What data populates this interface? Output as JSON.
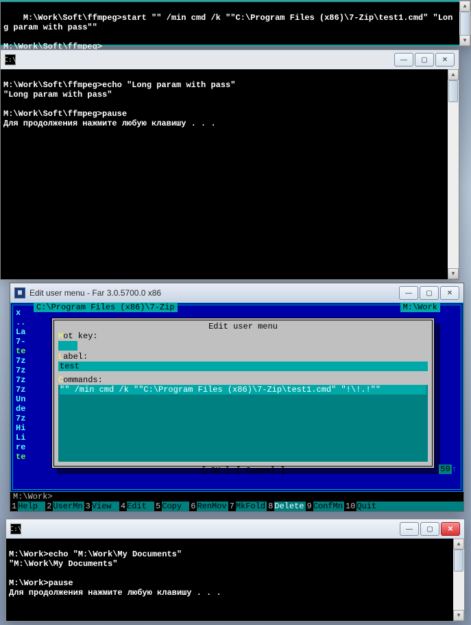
{
  "win1": {
    "line1": "M:\\Work\\Soft\\ffmpeg>start \"\" /min cmd /k \"\"C:\\Program Files (x86)\\7-Zip\\test1.cmd\" \"Long param with pass\"\"",
    "line2": "",
    "line3": "M:\\Work\\Soft\\ffmpeg>"
  },
  "win2": {
    "title": "",
    "lines": [
      "M:\\Work\\Soft\\ffmpeg>echo \"Long param with pass\"",
      "\"Long param with pass\"",
      "",
      "M:\\Work\\Soft\\ffmpeg>pause",
      "Для продолжения нажмите любую клавишу . . ."
    ]
  },
  "win3": {
    "title": "Edit user menu - Far 3.0.5700.0 x86",
    "path_left": "C:\\Program Files (x86)\\7-Zip",
    "path_right": "M:\\Work",
    "left_items": [
      "x",
      "..",
      "La",
      "7-",
      "te",
      "7z",
      "7z",
      "7z",
      "7z",
      "Un",
      "de",
      "7z",
      "Hi",
      "Li",
      "re",
      "",
      "te"
    ],
    "dialog": {
      "title": " Edit user menu ",
      "hotkey_label": "Hot key:",
      "hotkey_value": "",
      "label_label": "Label:",
      "label_value": "test",
      "commands_label": "Commands:",
      "command_line": "\"\" /min cmd /k \"\"C:\\Program Files (x86)\\7-Zip\\test1.cmd\" \"!\\!.!\"\"",
      "ok": "OK",
      "cancel": "Cancel"
    },
    "prompt": "M:\\Work>",
    "status_num": "59",
    "keybar": [
      {
        "n": "1",
        "l": "Help"
      },
      {
        "n": "2",
        "l": "UserMn"
      },
      {
        "n": "3",
        "l": "View"
      },
      {
        "n": "4",
        "l": "Edit"
      },
      {
        "n": "5",
        "l": "Copy"
      },
      {
        "n": "6",
        "l": "RenMov"
      },
      {
        "n": "7",
        "l": "MkFold"
      },
      {
        "n": "8",
        "l": "Delete"
      },
      {
        "n": "9",
        "l": "ConfMn"
      },
      {
        "n": "10",
        "l": "Quit"
      }
    ]
  },
  "win4": {
    "title": "",
    "lines": [
      "M:\\Work>echo \"M:\\Work\\My Documents\"",
      "\"M:\\Work\\My Documents\"",
      "",
      "M:\\Work>pause",
      "Для продолжения нажмите любую клавишу . . ."
    ]
  },
  "win_btn": {
    "min": "—",
    "max": "▢",
    "close": "✕"
  },
  "icons": {
    "cmd": "C:\\",
    "far": "▦"
  }
}
